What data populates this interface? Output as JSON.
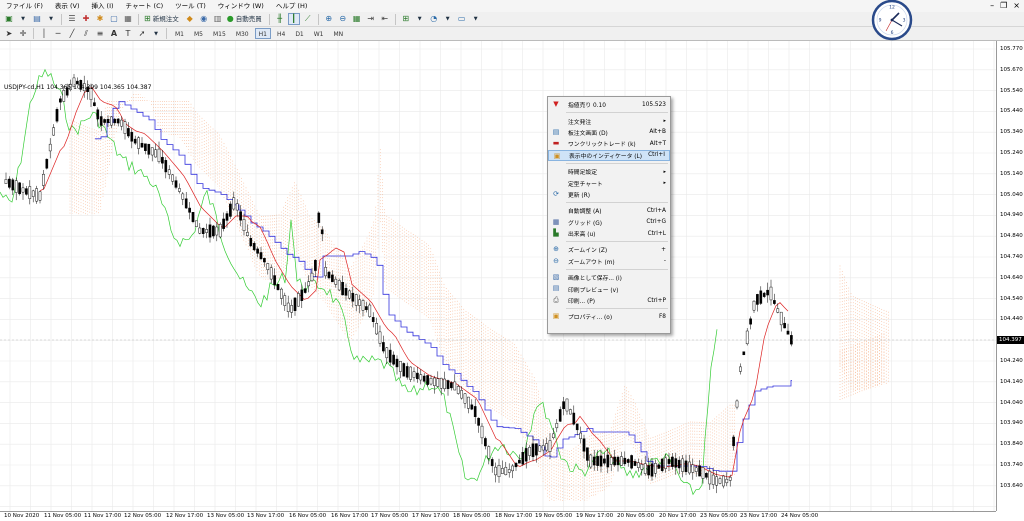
{
  "menubar": [
    "ファイル (F)",
    "表示 (V)",
    "挿入 (I)",
    "チャート (C)",
    "ツール (T)",
    "ウィンドウ (W)",
    "ヘルプ (H)"
  ],
  "toolbar": {
    "new_order": "新規注文",
    "auto_trade": "自動売買"
  },
  "timeframes": [
    "M1",
    "M5",
    "M15",
    "M30",
    "H1",
    "H4",
    "D1",
    "W1",
    "MN"
  ],
  "active_timeframe": "H1",
  "chart_title": "USDJPY-cd,H1  104.365 104.399 104.365 104.387",
  "current_price": "104.397",
  "price_labels": [
    "105.770",
    "105.670",
    "105.540",
    "105.440",
    "105.340",
    "105.240",
    "105.140",
    "105.040",
    "104.940",
    "104.840",
    "104.740",
    "104.640",
    "104.540",
    "104.440",
    "104.340",
    "104.240",
    "104.140",
    "104.040",
    "103.940",
    "103.840",
    "103.740",
    "103.640"
  ],
  "time_labels": [
    "10 Nov 2020",
    "11 Nov 05:00",
    "11 Nov 17:00",
    "12 Nov 05:00",
    "12 Nov 17:00",
    "13 Nov 05:00",
    "13 Nov 17:00",
    "16 Nov 05:00",
    "16 Nov 17:00",
    "17 Nov 05:00",
    "17 Nov 17:00",
    "18 Nov 05:00",
    "18 Nov 17:00",
    "19 Nov 05:00",
    "19 Nov 17:00",
    "20 Nov 05:00",
    "20 Nov 17:00",
    "23 Nov 05:00",
    "23 Nov 17:00",
    "24 Nov 05:00"
  ],
  "context_menu": {
    "sell_label": "指値売り 0.10",
    "sell_price": "105.523",
    "items": [
      {
        "label": "注文発注",
        "shortcut": "",
        "arrow": "▸"
      },
      {
        "label": "板注文画面 (D)",
        "shortcut": "Alt+B"
      },
      {
        "label": "ワンクリックトレード (k)",
        "shortcut": "Alt+T"
      },
      {
        "label": "表示中のインディケータ (L)",
        "shortcut": "Ctrl+I"
      },
      {
        "label": "時間足設定",
        "shortcut": "",
        "arrow": "▸"
      },
      {
        "label": "定型チャート",
        "shortcut": "",
        "arrow": "▸"
      },
      {
        "label": "更新 (R)",
        "shortcut": ""
      },
      {
        "label": "自動調整 (A)",
        "shortcut": "Ctrl+A"
      },
      {
        "label": "グリッド (G)",
        "shortcut": "Ctrl+G"
      },
      {
        "label": "出来高 (u)",
        "shortcut": "Ctrl+L"
      },
      {
        "label": "ズームイン (Z)",
        "shortcut": "+"
      },
      {
        "label": "ズームアウト (m)",
        "shortcut": "-"
      },
      {
        "label": "画像として保存... (i)",
        "shortcut": ""
      },
      {
        "label": "印刷プレビュー (v)",
        "shortcut": ""
      },
      {
        "label": "印刷... (P)",
        "shortcut": "Ctrl+P"
      },
      {
        "label": "プロパティ... (o)",
        "shortcut": "F8"
      }
    ]
  },
  "colors": {
    "bull": "#000000",
    "bear": "#000000",
    "kijun": "#3333dd",
    "tenkan": "#dd2222",
    "chikou": "#33cc33",
    "cloud": "#f4a070",
    "grid": "#e9e9e9"
  },
  "icons": [
    "new-chart-icon",
    "profiles-icon",
    "zoom-in-icon",
    "zoom-out-icon",
    "tile-icon",
    "clock-icon",
    "cursor-icon",
    "crosshair-icon",
    "trendline-icon",
    "text-icon"
  ]
}
